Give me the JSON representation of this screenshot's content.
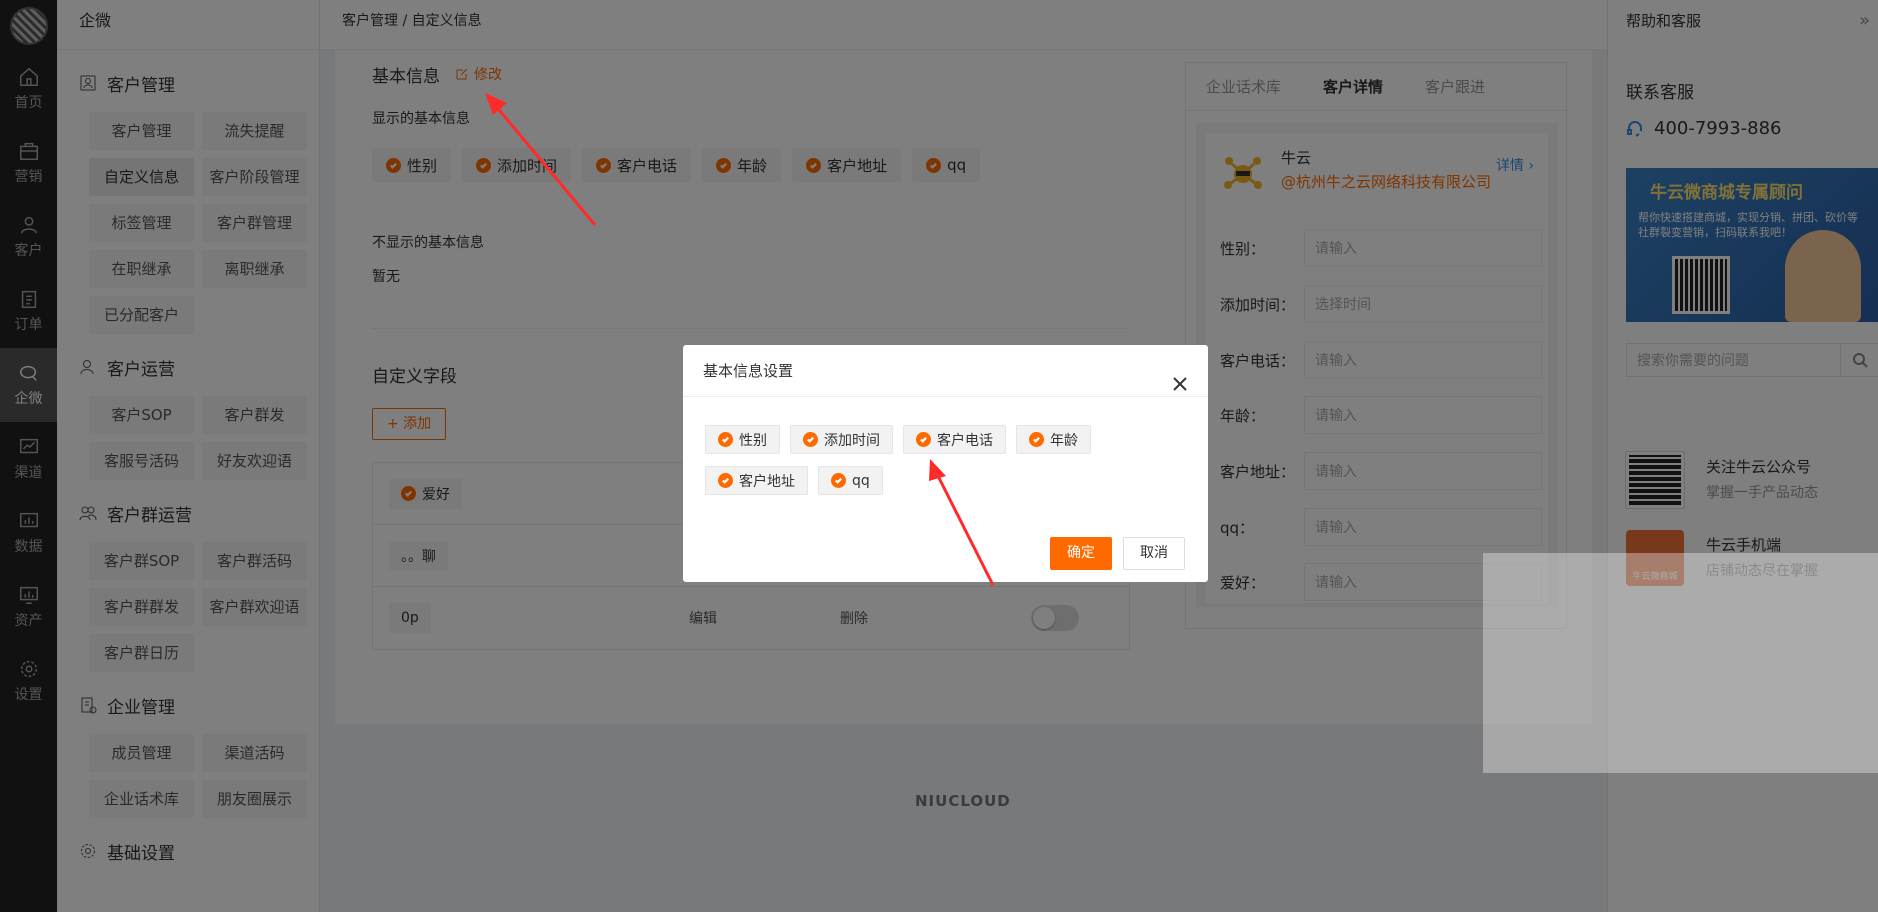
{
  "nav": {
    "items": [
      {
        "label": "首页",
        "icon": "home-icon"
      },
      {
        "label": "营销",
        "icon": "bag-icon"
      },
      {
        "label": "客户",
        "icon": "user-icon"
      },
      {
        "label": "订单",
        "icon": "clipboard-icon"
      },
      {
        "label": "企微",
        "icon": "chat-icon",
        "active": true
      },
      {
        "label": "渠道",
        "icon": "chart-icon"
      },
      {
        "label": "数据",
        "icon": "bar-chart-icon"
      },
      {
        "label": "资产",
        "icon": "monitor-icon"
      },
      {
        "label": "设置",
        "icon": "gear-icon"
      }
    ]
  },
  "submenu": {
    "brand": "企微",
    "groups": [
      {
        "title": "客户管理",
        "items": [
          "客户管理",
          "流失提醒",
          "自定义信息",
          "客户阶段管理",
          "标签管理",
          "客户群管理",
          "在职继承",
          "离职继承",
          "已分配客户"
        ]
      },
      {
        "title": "客户运营",
        "items": [
          "客户SOP",
          "客户群发",
          "客服号活码",
          "好友欢迎语"
        ]
      },
      {
        "title": "客户群运营",
        "items": [
          "客户群SOP",
          "客户群活码",
          "客户群群发",
          "客户群欢迎语",
          "客户群日历"
        ]
      },
      {
        "title": "企业管理",
        "items": [
          "成员管理",
          "渠道活码",
          "企业话术库",
          "朋友圈展示"
        ]
      },
      {
        "title": "基础设置",
        "items": []
      }
    ]
  },
  "header": {
    "breadcrumb": "客户管理 / 自定义信息"
  },
  "main": {
    "basic_info_title": "基本信息",
    "edit_label": "修改",
    "shown_label": "显示的基本信息",
    "shown_tags": [
      "性别",
      "添加时间",
      "客户电话",
      "年龄",
      "客户地址",
      "qq"
    ],
    "hidden_label": "不显示的基本信息",
    "hidden_value": "暂无",
    "custom_title": "自定义字段",
    "add_label": "+ 添加",
    "custom_rows": [
      {
        "chip": "爱好",
        "checked": true
      },
      {
        "chip": "。。聊",
        "checked": false
      },
      {
        "chip": "0p",
        "checked": false,
        "edit": "编辑",
        "delete": "删除"
      }
    ]
  },
  "preview": {
    "tabs": [
      "企业话术库",
      "客户详情",
      "客户跟进"
    ],
    "name": "牛云",
    "company": "@杭州牛之云网络科技有限公司",
    "detail": "详情 ›",
    "fields": [
      {
        "label": "性别：",
        "placeholder": "请输入"
      },
      {
        "label": "添加时间：",
        "placeholder": "选择时间"
      },
      {
        "label": "客户电话：",
        "placeholder": "请输入"
      },
      {
        "label": "年龄：",
        "placeholder": "请输入"
      },
      {
        "label": "客户地址：",
        "placeholder": "请输入"
      },
      {
        "label": "qq：",
        "placeholder": "请输入"
      },
      {
        "label": "爱好：",
        "placeholder": "请输入"
      }
    ]
  },
  "help": {
    "title": "帮助和客服",
    "chevron": "»",
    "contact": "联系客服",
    "phone": "400-7993-886",
    "banner_title": "牛云微商城专属顾问",
    "banner_sub": "帮你快速搭建商城，实现分销、拼团、砍价等社群裂变营销，扫码联系我吧！",
    "search_placeholder": "搜索你需要的问题",
    "links": [
      {
        "title": "关注牛云公众号",
        "sub": "掌握一手产品动态",
        "thumb_text": ""
      },
      {
        "title": "牛云手机端",
        "sub": "店铺动态尽在掌握",
        "thumb_text": "牛云微商城"
      }
    ]
  },
  "dialog": {
    "title": "基本信息设置",
    "tags": [
      "性别",
      "添加时间",
      "客户电话",
      "年龄",
      "客户地址",
      "qq"
    ],
    "ok": "确定",
    "cancel": "取消"
  },
  "footer": {
    "logo": "NIUCLOUD"
  },
  "colors": {
    "accent": "#ff6a00",
    "link": "#3a8ee6",
    "nav_bg": "#222222"
  }
}
